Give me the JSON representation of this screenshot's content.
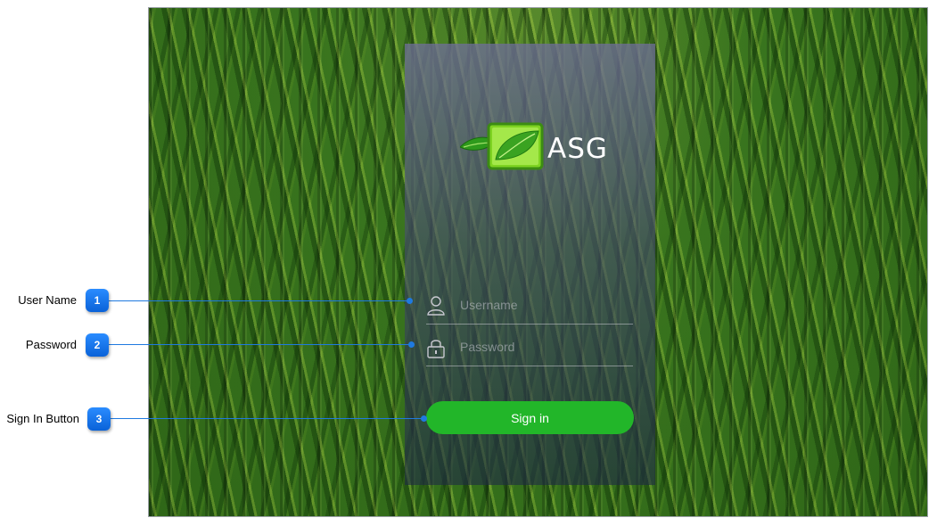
{
  "login": {
    "brand": "ASG",
    "username_placeholder": "Username",
    "password_placeholder": "Password",
    "signin_label": "Sign in"
  },
  "icons": {
    "logo": "asg-leaf-logo-icon",
    "user": "user-icon",
    "lock": "lock-icon"
  },
  "callouts": [
    {
      "number": "1",
      "label": "User Name"
    },
    {
      "number": "2",
      "label": "Password"
    },
    {
      "number": "3",
      "label": "Sign In Button"
    }
  ],
  "colors": {
    "signin_button": "#22b629",
    "callout_badge": "#0a62d8",
    "leaf_green": "#7ed321"
  }
}
